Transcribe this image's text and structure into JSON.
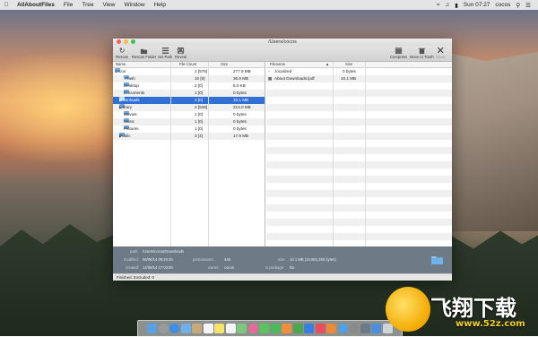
{
  "menubar": {
    "app_name": "AllAboutFiles",
    "items": [
      "File",
      "Tree",
      "View",
      "Window",
      "Help"
    ],
    "clock": "Sun 07:27",
    "user": "cocos"
  },
  "window": {
    "title": "/Users/cocos",
    "toolbar": {
      "rescan": "Rescan",
      "rescan_folder": "Rescan Folder",
      "set_path": "Set Path",
      "reveal": "Reveal",
      "compress": "Compress",
      "move_to_trash": "Move to Trash",
      "show": "Show"
    },
    "tree": {
      "headers": {
        "name": "Name",
        "file_count": "File Count",
        "size": "Size"
      },
      "rows": [
        {
          "name": "cocos",
          "count": "2 [576]",
          "size": "277.9 MB"
        },
        {
          "name": ".Trash",
          "count": "10 [0]",
          "size": "36.9 MB"
        },
        {
          "name": "Desktop",
          "count": "2 [0]",
          "size": "6.0 KB"
        },
        {
          "name": "Documents",
          "count": "1 [0]",
          "size": "0 bytes"
        },
        {
          "name": "Downloads",
          "count": "2 [0]",
          "size": "10.1 MB"
        },
        {
          "name": "Library",
          "count": "2 [549]",
          "size": "213.0 MB"
        },
        {
          "name": "Movies",
          "count": "1 [0]",
          "size": "0 bytes"
        },
        {
          "name": "Music",
          "count": "1 [0]",
          "size": "0 bytes"
        },
        {
          "name": "Pictures",
          "count": "1 [0]",
          "size": "0 bytes"
        },
        {
          "name": "Public",
          "count": "3 [4]",
          "size": "17.9 MB"
        }
      ]
    },
    "files": {
      "headers": {
        "filename": "Filename",
        "size": "Size"
      },
      "rows": [
        {
          "name": ".localized",
          "size": "0 bytes"
        },
        {
          "name": "About Downloads.lpdf",
          "size": "10.1 MB"
        }
      ]
    },
    "info": {
      "path_label": "path:",
      "path": "/Users/cocos/Downloads",
      "modified_label": "modified:",
      "modified": "06/08/14 09:20:46",
      "created_label": "created:",
      "created": "14/06/14 17:03:00",
      "permissions_label": "permissions:",
      "permissions": "448",
      "owner_label": "owner:",
      "owner": "cocos",
      "size_label": "size:",
      "size": "10.1 MB  (10,584,250 bytes)",
      "package_label": "is package:",
      "package": "No"
    },
    "status": "Finished.  Excluded: 0"
  },
  "watermark": {
    "text": "飞翔下载",
    "url": "www.52z.com"
  },
  "colors": {
    "selection": "#2f6fd6",
    "info_bar": "#6e7b87"
  }
}
